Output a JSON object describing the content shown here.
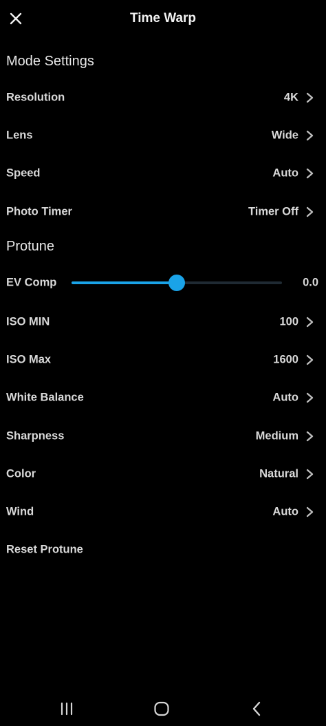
{
  "header": {
    "title": "Time Warp",
    "close_icon": "close-icon"
  },
  "sections": {
    "mode": "Mode Settings",
    "protune": "Protune"
  },
  "mode_settings": [
    {
      "label": "Resolution",
      "value": "4K"
    },
    {
      "label": "Lens",
      "value": "Wide"
    },
    {
      "label": "Speed",
      "value": "Auto"
    },
    {
      "label": "Photo Timer",
      "value": "Timer Off"
    }
  ],
  "ev_comp": {
    "label": "EV Comp",
    "value": "0.0",
    "level": 0.5
  },
  "protune_settings": [
    {
      "label": "ISO MIN",
      "value": "100"
    },
    {
      "label": "ISO Max",
      "value": "1600"
    },
    {
      "label": "White Balance",
      "value": "Auto"
    },
    {
      "label": "Sharpness",
      "value": "Medium"
    },
    {
      "label": "Color",
      "value": "Natural"
    },
    {
      "label": "Wind",
      "value": "Auto"
    }
  ],
  "reset": {
    "label": "Reset Protune"
  },
  "nav_bar": {
    "icons": [
      "recent-apps-icon",
      "home-icon",
      "back-icon"
    ]
  },
  "colors": {
    "accent": "#1aa3e8",
    "background": "#000000",
    "text": "#d9d9d9"
  }
}
